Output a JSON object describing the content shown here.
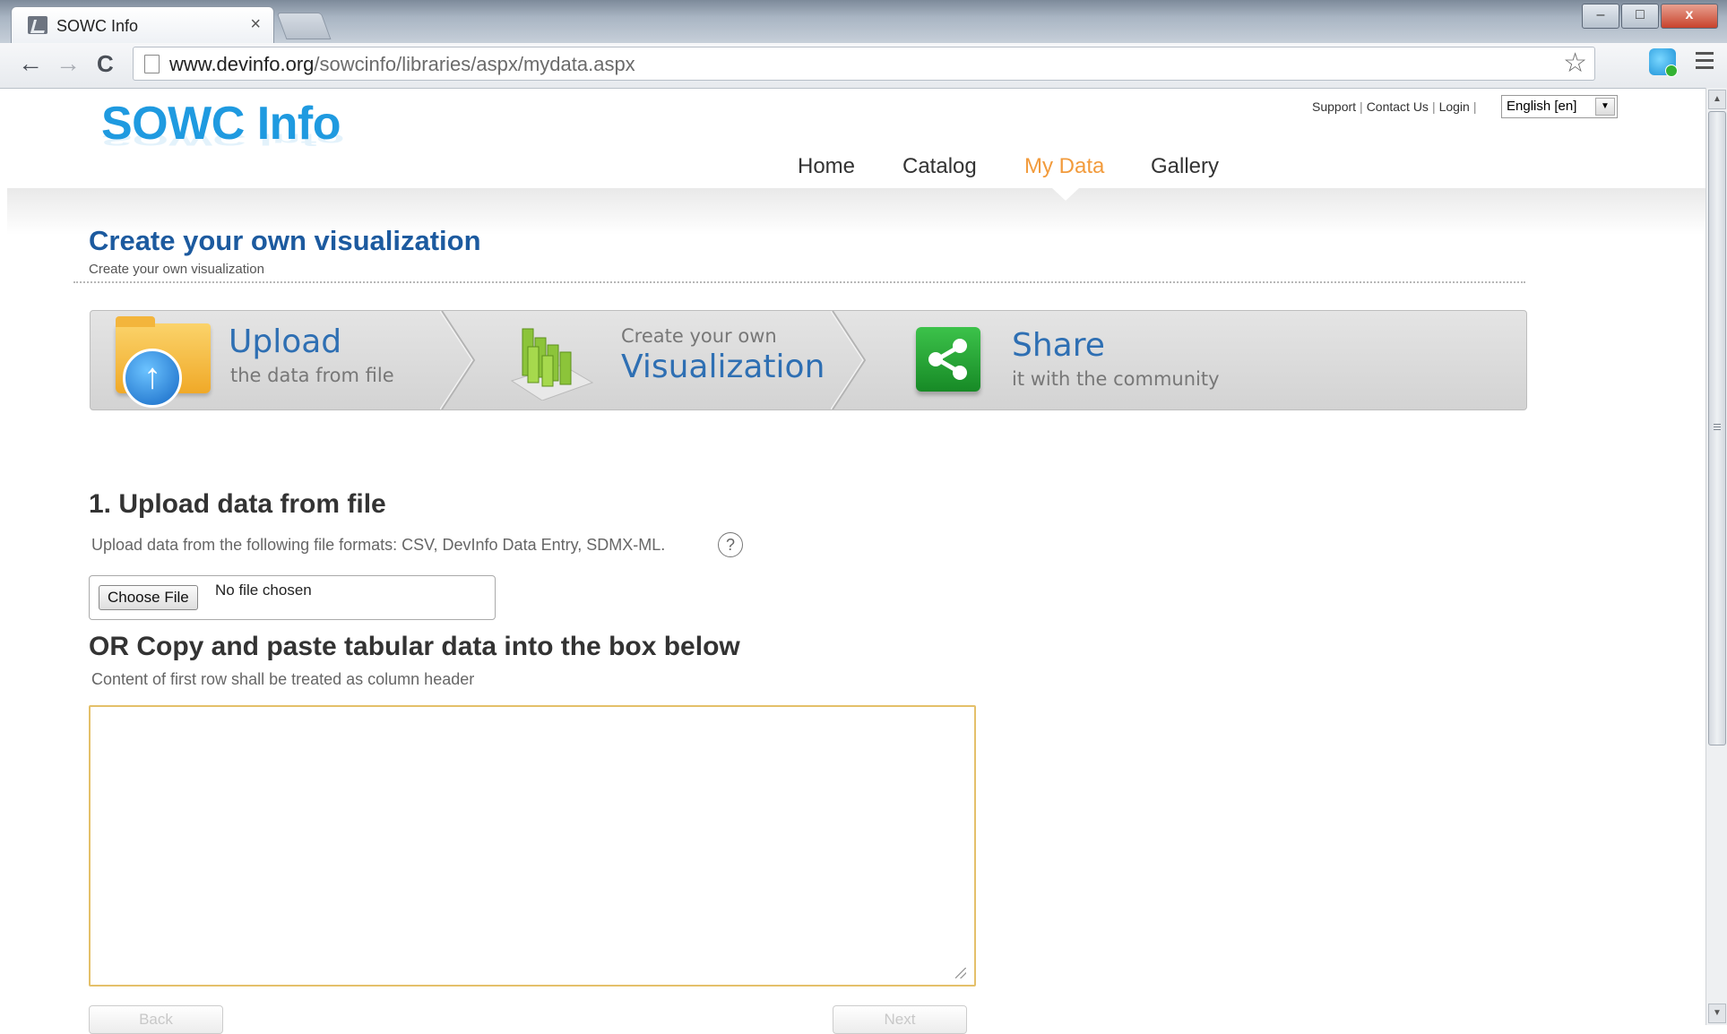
{
  "browser": {
    "tab_title": "SOWC Info",
    "tab_close": "×",
    "url_host": "www.devinfo.org",
    "url_path": "/sowcinfo/libraries/aspx/mydata.aspx",
    "back_icon": "←",
    "forward_icon": "→",
    "reload_icon": "C",
    "star_icon": "☆",
    "window_buttons": {
      "minimize": "–",
      "maximize": "□",
      "close": "x"
    }
  },
  "header": {
    "logo": "SOWC Info",
    "links": [
      "Support",
      "Contact Us",
      "Login"
    ],
    "language": "English [en]",
    "nav": [
      "Home",
      "Catalog",
      "My Data",
      "Gallery"
    ],
    "active_nav": "My Data"
  },
  "page": {
    "title": "Create your own visualization",
    "subtitle": "Create your own visualization"
  },
  "steps": [
    {
      "big": "Upload",
      "small": "the data from file",
      "icon": "folder-upload-icon"
    },
    {
      "small": "Create your own",
      "big": "Visualization",
      "icon": "bar-chart-icon"
    },
    {
      "big": "Share",
      "small": "it with the community",
      "icon": "share-icon"
    }
  ],
  "upload": {
    "heading": "1. Upload data from file",
    "hint": "Upload data from the following file formats: CSV, DevInfo Data Entry, SDMX-ML.",
    "help_icon": "?",
    "choose_label": "Choose File",
    "no_file": "No file chosen"
  },
  "paste": {
    "heading": "OR Copy and paste tabular data into the box below",
    "hint": "Content of first row shall be treated as column header",
    "value": ""
  },
  "buttons": {
    "back": "Back",
    "next": "Next"
  },
  "colors": {
    "logo": "#1f9ae0",
    "title": "#1c5a9f",
    "active_nav": "#f29b3c",
    "textarea_border": "#e4c06a"
  }
}
